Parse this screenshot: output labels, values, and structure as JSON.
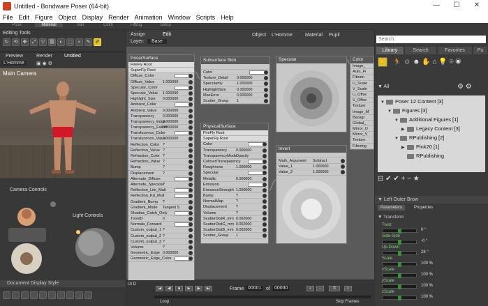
{
  "window": {
    "title": "Untitled - Bondware Poser (64-bit)",
    "minimize": "—",
    "maximize": "☐",
    "close": "✕"
  },
  "menu": [
    "File",
    "Edit",
    "Figure",
    "Object",
    "Display",
    "Render",
    "Animation",
    "Window",
    "Scripts",
    "Help"
  ],
  "rooms": [
    "Pose",
    "Material",
    "Hair",
    "Cloth",
    "Fitting",
    "Setup"
  ],
  "editing_tools_label": "Editing Tools",
  "doc_tabs": {
    "preview": "Preview",
    "render": "Render",
    "untitled": "Untitled"
  },
  "doc_figure_select": "L'Homme",
  "viewport": {
    "camera_label": "Main Camera"
  },
  "camera_controls_label": "Camera Controls",
  "light_controls_label": "Light Controls",
  "doc_display_style_label": "Document Display Style",
  "material": {
    "tabs": [
      "Assign",
      "Edit"
    ],
    "layer_label": "Layer:",
    "layer_value": "Base",
    "object_label": "Object",
    "object_value": "L'Homme",
    "material_label": "Material",
    "material_value": "Pupil"
  },
  "poser_surface": {
    "title": "PoserSurface",
    "checks": [
      "FireFly Root",
      "SuperFly Root"
    ],
    "rows": [
      {
        "n": "Diffuse_Color",
        "v": ""
      },
      {
        "n": "Diffuse_Value",
        "v": "1.000000"
      },
      {
        "n": "Specular_Color",
        "v": ""
      },
      {
        "n": "Specular_Value",
        "v": "1.000000"
      },
      {
        "n": "Highlight_Size",
        "v": "0.000000"
      },
      {
        "n": "Ambient_Color",
        "v": ""
      },
      {
        "n": "Ambient_Value",
        "v": "0.000000"
      },
      {
        "n": "Transparency",
        "v": "0.000000"
      },
      {
        "n": "Transparency_Edge",
        "v": "0.000000"
      },
      {
        "n": "Transparency_Falloff",
        "v": "0.000000"
      },
      {
        "n": "Translucence_Color",
        "v": ""
      },
      {
        "n": "Translucence_Value",
        "v": "0.000000"
      },
      {
        "n": "Reflection_Color",
        "v": "?"
      },
      {
        "n": "Reflection_Value",
        "v": "?"
      },
      {
        "n": "Refraction_Color",
        "v": "?"
      },
      {
        "n": "Refraction_Value",
        "v": "?"
      },
      {
        "n": "Bump",
        "v": "?"
      },
      {
        "n": "Displacement",
        "v": "?"
      },
      {
        "n": "Alternate_Diffuse",
        "v": ""
      },
      {
        "n": "Alternate_Specular",
        "v": "?"
      },
      {
        "n": "Reflection_Lite_Mult",
        "v": ""
      },
      {
        "n": "Reflection_Kd_Mult",
        "v": ""
      },
      {
        "n": "Gradient_Bump",
        "v": "?"
      },
      {
        "n": "Gradient_Mode",
        "v": "Tangent S"
      },
      {
        "n": "Shadow_Catch_Only",
        "v": ""
      },
      {
        "n": "ToonID",
        "v": "0"
      },
      {
        "n": "Normals_Forward",
        "v": ""
      },
      {
        "n": "Custom_output_1",
        "v": "?"
      },
      {
        "n": "Custom_output_2",
        "v": "?"
      },
      {
        "n": "Custom_output_3",
        "v": "?"
      },
      {
        "n": "Volume",
        "v": "?"
      },
      {
        "n": "Geometric_Edge",
        "v": "0.000000"
      },
      {
        "n": "Geometric_Edge_Color",
        "v": ""
      }
    ]
  },
  "subsurface": {
    "title": "Subsurface Skin",
    "rows": [
      {
        "n": "Color",
        "v": ""
      },
      {
        "n": "Texture_Detail",
        "v": "0.000000"
      },
      {
        "n": "Specularity",
        "v": "1.000000"
      },
      {
        "n": "HighlightSize",
        "v": "0.300000"
      },
      {
        "n": "MaxError",
        "v": "0.000000"
      },
      {
        "n": "Scatter_Group",
        "v": "1"
      }
    ]
  },
  "specular": {
    "title": "Specular"
  },
  "color_node": {
    "title": "Color",
    "rows": [
      "Image_",
      "Auto_Fi",
      "Filterin",
      "U_Scale",
      "V_Scale",
      "U_Offse",
      "V_Offse",
      "Texture",
      "Image_M",
      "Backgr",
      "Global_",
      "Mirror_U",
      "Mirror_V",
      "Texture",
      "Filtering"
    ]
  },
  "physical": {
    "title": "PhysicalSurface",
    "checks": [
      "FireFly Root",
      "SuperFly Root"
    ],
    "rows": [
      {
        "n": "Color",
        "v": ""
      },
      {
        "n": "Transparency",
        "v": "0.000000"
      },
      {
        "n": "TransparencyMode",
        "v": "Opacity"
      },
      {
        "n": "ColoredTransparency",
        "v": ""
      },
      {
        "n": "Roughness",
        "v": "1.000000"
      },
      {
        "n": "Specular",
        "v": ""
      },
      {
        "n": "Metallic",
        "v": "0.000000"
      },
      {
        "n": "Emission",
        "v": ""
      },
      {
        "n": "EmissionStrength",
        "v": "1.000000"
      },
      {
        "n": "Bump",
        "v": "?"
      },
      {
        "n": "NormalMap",
        "v": "?"
      },
      {
        "n": "Displacement",
        "v": "?"
      },
      {
        "n": "Volume",
        "v": "?"
      },
      {
        "n": "ScatterDistR_mm",
        "v": "0.002000"
      },
      {
        "n": "ScatterDistG_mm",
        "v": "0.002000"
      },
      {
        "n": "ScatterDistB_mm",
        "v": "0.002000"
      },
      {
        "n": "Scatter_Group",
        "v": "1"
      }
    ]
  },
  "invert": {
    "title": "Invert",
    "rows": [
      {
        "n": "Math_Argument",
        "v": "Subtract"
      },
      {
        "n": "Value_1",
        "v": "1.000000"
      },
      {
        "n": "Value_2",
        "v": "1.000000"
      }
    ]
  },
  "library": {
    "tabs": [
      "Library",
      "Search",
      "Favorites",
      "Pu"
    ],
    "search_placeholder": "Search",
    "filter_label": "All",
    "tree": [
      {
        "label": "Poser 12 Content",
        "count": "[3]",
        "indent": 0,
        "arrow": "▼"
      },
      {
        "label": "Figures",
        "count": "[3]",
        "indent": 1,
        "arrow": "▼"
      },
      {
        "label": "Additional Figures",
        "count": "[1]",
        "indent": 2,
        "arrow": "▼"
      },
      {
        "label": "Legacy Content",
        "count": "[3]",
        "indent": 3,
        "arrow": "▶"
      },
      {
        "label": "RPublishing",
        "count": "[2]",
        "indent": 2,
        "arrow": "▼"
      },
      {
        "label": "Pink20",
        "count": "[1]",
        "indent": 3,
        "arrow": "▶"
      },
      {
        "label": "RPublishing",
        "count": "",
        "indent": 3,
        "arrow": ""
      }
    ]
  },
  "parameters": {
    "title": "Left Outer Brow",
    "tabs": [
      "Parameters",
      "Properties"
    ],
    "group": "Transform",
    "items": [
      {
        "n": "Twist",
        "v": "0 °"
      },
      {
        "n": "Side-Side",
        "v": "-0 °"
      },
      {
        "n": "Up-Down",
        "v": "28 °"
      },
      {
        "n": "Scale",
        "v": "100 %"
      },
      {
        "n": "xScale",
        "v": "100 %"
      },
      {
        "n": "yScale",
        "v": "100 %"
      },
      {
        "n": "zScale",
        "v": "100 %"
      }
    ]
  },
  "timeline": {
    "frame_label": "Frame",
    "frame_value": "00001",
    "of_label": "of",
    "total_frames": "00030",
    "loop_label": "Loop",
    "skip_frames_label": "Skip Frames",
    "ui_label": "UI D"
  }
}
